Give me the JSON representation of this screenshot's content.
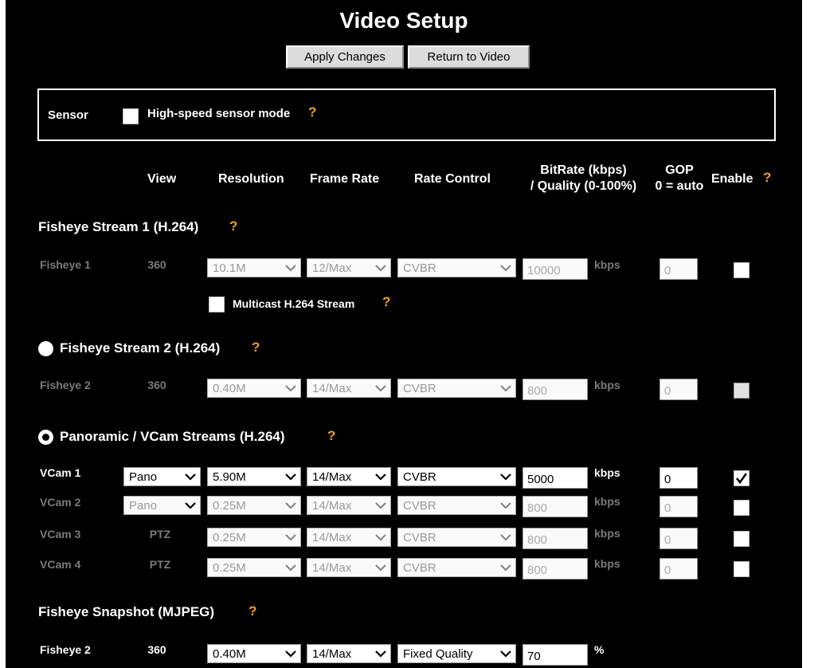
{
  "title": "Video Setup",
  "buttons": {
    "apply": "Apply Changes",
    "return": "Return to Video"
  },
  "sensor": {
    "label": "Sensor",
    "mode_label": "High-speed sensor mode",
    "checked": false
  },
  "help": "?",
  "headers": {
    "view": "View",
    "resolution": "Resolution",
    "frame_rate": "Frame Rate",
    "rate_control": "Rate Control",
    "bitrate_1": "BitRate (kbps)",
    "bitrate_2": "/ Quality (0-100%)",
    "gop_1": "GOP",
    "gop_2": "0 = auto",
    "enable": "Enable"
  },
  "stream1": {
    "title": "Fisheye Stream 1 (H.264)",
    "name": "Fisheye 1",
    "view": "360",
    "resolution": "10.1M",
    "frame_rate": "12/Max",
    "rate_control": "CVBR",
    "bitrate": "10000",
    "unit": "kbps",
    "gop": "0",
    "multicast_label": "Multicast H.264 Stream"
  },
  "stream2": {
    "title": "Fisheye Stream 2 (H.264)",
    "name": "Fisheye 2",
    "view": "360",
    "resolution": "0.40M",
    "frame_rate": "14/Max",
    "rate_control": "CVBR",
    "bitrate": "800",
    "unit": "kbps",
    "gop": "0"
  },
  "panoramic": {
    "title": "Panoramic / VCam Streams (H.264)",
    "rows": [
      {
        "name": "VCam 1",
        "view": "Pano",
        "resolution": "5.90M",
        "frame_rate": "14/Max",
        "rate_control": "CVBR",
        "bitrate": "5000",
        "unit": "kbps",
        "gop": "0",
        "enabled": true
      },
      {
        "name": "VCam 2",
        "view": "Pano",
        "resolution": "0.25M",
        "frame_rate": "14/Max",
        "rate_control": "CVBR",
        "bitrate": "800",
        "unit": "kbps",
        "gop": "0",
        "enabled": false
      },
      {
        "name": "VCam 3",
        "view": "PTZ",
        "resolution": "0.25M",
        "frame_rate": "14/Max",
        "rate_control": "CVBR",
        "bitrate": "800",
        "unit": "kbps",
        "gop": "0",
        "enabled": false
      },
      {
        "name": "VCam 4",
        "view": "PTZ",
        "resolution": "0.25M",
        "frame_rate": "14/Max",
        "rate_control": "CVBR",
        "bitrate": "800",
        "unit": "kbps",
        "gop": "0",
        "enabled": false
      }
    ]
  },
  "snapshot": {
    "title": "Fisheye Snapshot (MJPEG)",
    "name": "Fisheye 2",
    "view": "360",
    "resolution": "0.40M",
    "frame_rate": "14/Max",
    "rate_control": "Fixed Quality",
    "quality": "70",
    "unit": "%"
  },
  "colors": {
    "background": "#000000",
    "help_icon": "#f0a020",
    "disabled_text": "#7a7a7a"
  },
  "icons": {
    "help": "question-mark-icon",
    "dropdown": "chevron-down-icon",
    "check": "checkmark-icon"
  }
}
